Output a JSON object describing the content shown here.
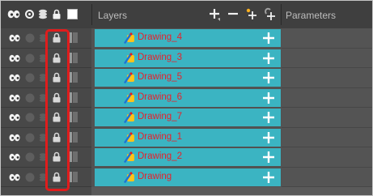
{
  "panel": {
    "layers_label": "Layers",
    "parameters_label": "Parameters"
  },
  "header_icons": [
    "show-all-icon",
    "solo-icon",
    "layer-stack-icon",
    "lock-icon",
    "color-swatch-icon"
  ],
  "toolbar_icons": [
    "add-layer-icon",
    "delete-layer-icon",
    "add-peg-icon",
    "add-effect-icon"
  ],
  "layers": [
    {
      "name": "Drawing_4"
    },
    {
      "name": "Drawing_3"
    },
    {
      "name": "Drawing_5"
    },
    {
      "name": "Drawing_6"
    },
    {
      "name": "Drawing_7"
    },
    {
      "name": "Drawing_1"
    },
    {
      "name": "Drawing_2"
    },
    {
      "name": "Drawing"
    }
  ],
  "colors": {
    "layer_row": "#3bb4c2",
    "layer_name": "#e8202a",
    "highlight": "#e01c1c",
    "header_bg": "#3f3f3f"
  }
}
